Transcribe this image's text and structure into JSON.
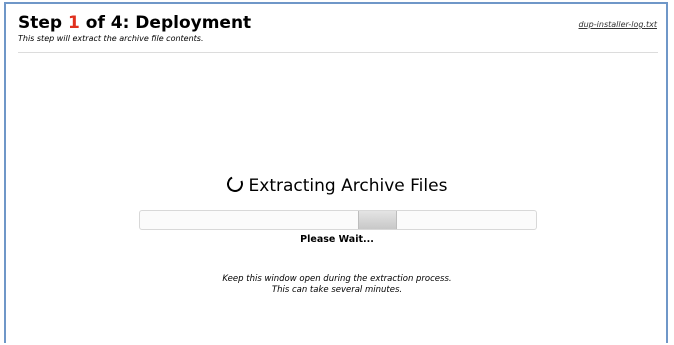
{
  "header": {
    "title_prefix": "Step ",
    "step_current": "1",
    "title_suffix": " of 4: Deployment",
    "subtitle": "This step will extract the archive file contents.",
    "log_link": "dup-installer-log.txt"
  },
  "status": {
    "icon": "spinner-icon",
    "label": "Extracting Archive Files",
    "wait_text": "Please Wait..."
  },
  "progress": {
    "indicator_start_fraction": 0.55,
    "indicator_width_fraction": 0.1
  },
  "note": {
    "line1": "Keep this window open during the extraction process.",
    "line2": "This can take several minutes."
  },
  "colors": {
    "step_accent": "#e0301e",
    "frame_border": "#6f97c8"
  }
}
